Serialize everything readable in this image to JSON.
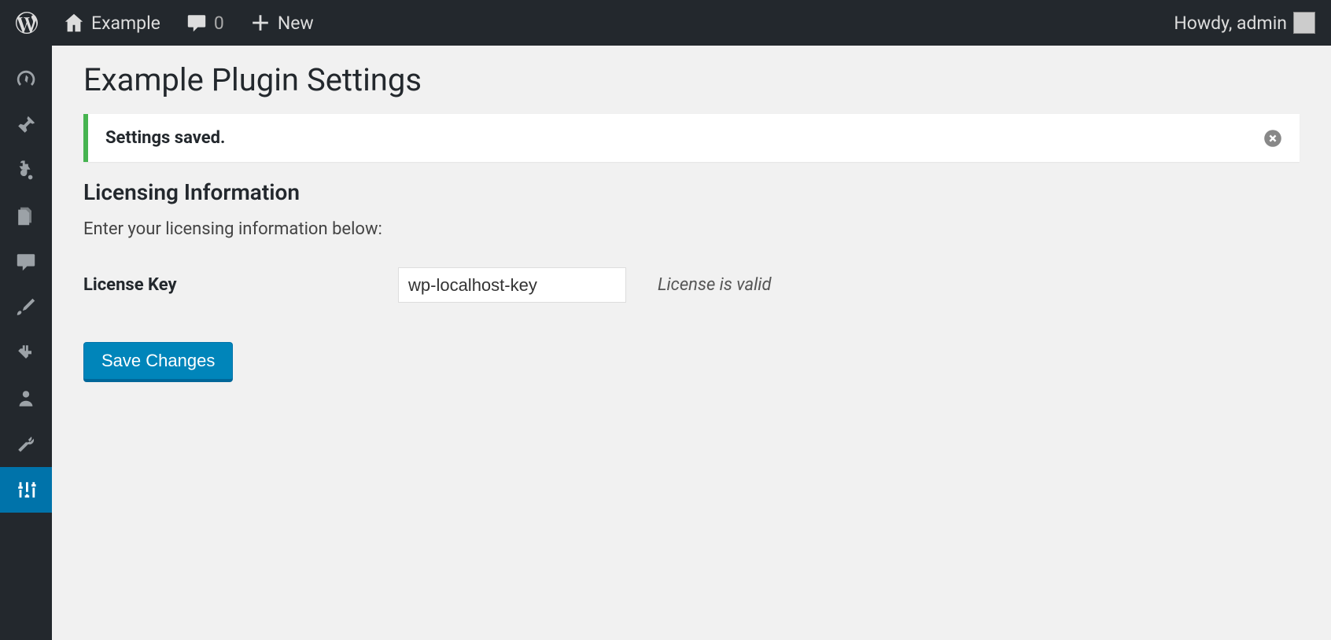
{
  "adminBar": {
    "siteName": "Example",
    "commentCount": "0",
    "newLabel": "New",
    "greeting": "Howdy, admin"
  },
  "sidebar": {
    "items": [
      {
        "icon": "dashboard"
      },
      {
        "icon": "pin"
      },
      {
        "icon": "media"
      },
      {
        "icon": "pages"
      },
      {
        "icon": "comments"
      },
      {
        "icon": "brush"
      },
      {
        "icon": "plugins"
      },
      {
        "icon": "users"
      },
      {
        "icon": "tools"
      },
      {
        "icon": "sliders",
        "current": true
      }
    ]
  },
  "page": {
    "title": "Example Plugin Settings"
  },
  "notice": {
    "message": "Settings saved."
  },
  "section": {
    "heading": "Licensing Information",
    "description": "Enter your licensing information below:"
  },
  "form": {
    "licenseKey": {
      "label": "License Key",
      "value": "wp-localhost-key",
      "hint": "License is valid"
    },
    "submitLabel": "Save Changes"
  }
}
